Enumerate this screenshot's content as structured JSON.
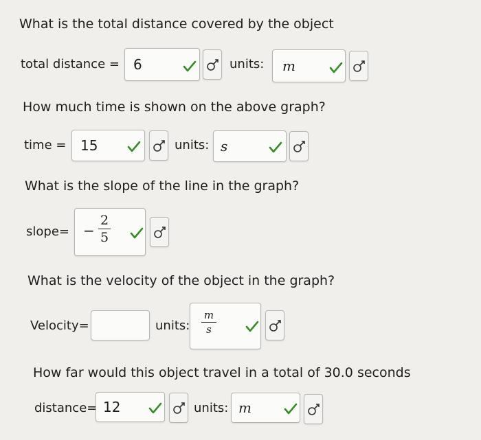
{
  "q1": {
    "question": "What is the total distance covered by the object",
    "label": "total distance =",
    "value": "6",
    "units_label": "units:",
    "units_value": "m"
  },
  "q2": {
    "question": "How much time is shown on the above graph?",
    "label": "time =",
    "value": "15",
    "units_label": "units:",
    "units_value": "s"
  },
  "q3": {
    "question": "What is the slope of the line in the graph?",
    "label": "slope=",
    "sign": "−",
    "numerator": "2",
    "denominator": "5"
  },
  "q4": {
    "question": "What is the velocity of the object in the graph?",
    "label": "Velocity=",
    "value": "",
    "units_label": "units:",
    "units_numerator": "m",
    "units_denominator": "s"
  },
  "q5": {
    "question": "How far would this object travel in a total of 30.0 seconds",
    "label": "distance=",
    "value": "12",
    "units_label": "units:",
    "units_value": "m"
  },
  "colors": {
    "check": "#3a8c2a",
    "border": "#b5b5b5",
    "background": "#f1efec"
  },
  "icons": {
    "correct": "checkmark-icon",
    "toggle": "symbol-toggle-icon"
  }
}
